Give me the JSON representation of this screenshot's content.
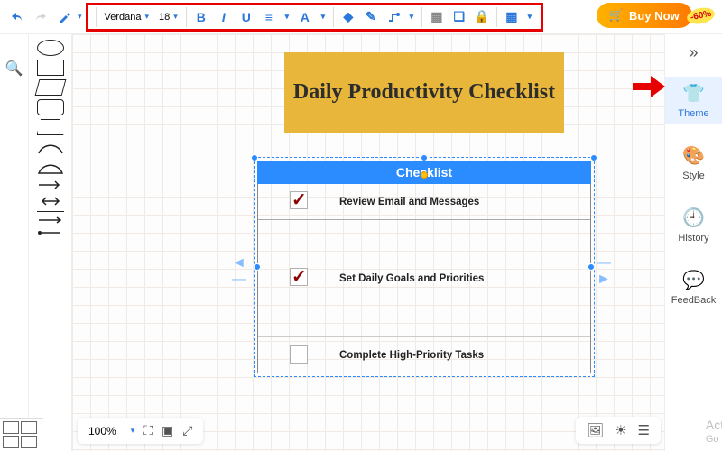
{
  "toolbar": {
    "font_family": "Verdana",
    "font_size": "18",
    "bold_label": "B",
    "italic_label": "I",
    "underline_label": "U"
  },
  "buy": {
    "label": "Buy Now",
    "discount": "-60%"
  },
  "canvas": {
    "title": "Daily Productivity Checklist",
    "checklist_header": "Checklist",
    "rows": [
      {
        "text": "Review Email and Messages",
        "checked": true
      },
      {
        "text": "Set Daily Goals and Priorities",
        "checked": true
      },
      {
        "text": "Complete High-Priority Tasks",
        "checked": false
      }
    ]
  },
  "bottom": {
    "zoom": "100%"
  },
  "right": {
    "theme": "Theme",
    "style": "Style",
    "history": "History",
    "feedback": "FeedBack"
  },
  "watermark": {
    "line1": "Activa",
    "line2": "Go to S"
  }
}
